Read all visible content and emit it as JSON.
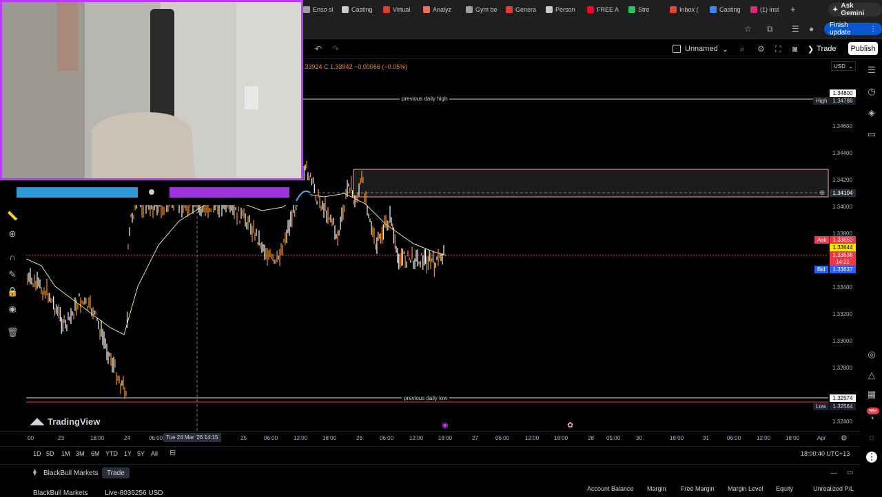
{
  "browser": {
    "tabs": [
      {
        "label": "Enso sl",
        "icon": "enso-icon",
        "color": "#9aa0a6"
      },
      {
        "label": "Casting",
        "icon": "casting-icon",
        "color": "#c8c8c8"
      },
      {
        "label": "Virtual",
        "icon": "virtual-icon",
        "color": "#e53935"
      },
      {
        "label": "Analyz",
        "icon": "analyze-icon",
        "color": "#ef6c57"
      },
      {
        "label": "Gym be",
        "icon": "gym-icon",
        "color": "#9aa0a6"
      },
      {
        "label": "Genera",
        "icon": "generate-icon",
        "color": "#e53935"
      },
      {
        "label": "Person",
        "icon": "person-icon",
        "color": "#c8c8c8"
      },
      {
        "label": "FREE A",
        "icon": "youtube-icon",
        "color": "#ff0033"
      },
      {
        "label": "Stre",
        "icon": "stream-icon",
        "color": "#22c55e"
      },
      {
        "label": "Inbox (",
        "icon": "gmail-icon",
        "color": "#ea4335"
      },
      {
        "label": "Casting",
        "icon": "casting2-icon",
        "color": "#3b82f6"
      },
      {
        "label": "(1) inst",
        "icon": "instagram-icon",
        "color": "#d62976"
      }
    ],
    "new_tab": "+",
    "ask_gemini": "Ask Gemini",
    "finish_update": "Finish update"
  },
  "toolbar": {
    "layout_name": "Unnamed",
    "trade": "Trade",
    "publish": "Publish"
  },
  "chart": {
    "ohlc_text": ".33924 C 1.33942 −0.00066 (−0.05%)",
    "currency": "USD",
    "levels": [
      {
        "name": "previous daily high",
        "price": "1.34788",
        "tag": "High"
      },
      {
        "name": "previous daily low",
        "price": "1.32564",
        "tag": "Low"
      }
    ],
    "price_ticks": [
      "1.34600",
      "1.34400",
      "1.34200",
      "1.34000",
      "1.33800",
      "1.33400",
      "1.33200",
      "1.33000",
      "1.32800",
      "1.32400"
    ],
    "highlight_labels": {
      "top": "1.34800",
      "crosshair": "1.34104",
      "ask_tag": "Ask",
      "ask_price": "1.33650",
      "mid_price": "1.33644",
      "bid_price_red": "1.33638",
      "countdown": "14:21",
      "bid_tag": "Bid",
      "bid_price": "1.33637",
      "low_top": "1.32574"
    },
    "time_labels": [
      {
        "text": ":00"
      },
      {
        "text": "23"
      },
      {
        "text": "18:00"
      },
      {
        "text": "24"
      },
      {
        "text": "06:00"
      },
      {
        "text": "25"
      },
      {
        "text": "06:00"
      },
      {
        "text": "12:00"
      },
      {
        "text": "18:00"
      },
      {
        "text": "26"
      },
      {
        "text": "06:00"
      },
      {
        "text": "12:00"
      },
      {
        "text": "18:00"
      },
      {
        "text": "27"
      },
      {
        "text": "06:00"
      },
      {
        "text": "12:00"
      },
      {
        "text": "18:00"
      },
      {
        "text": "28"
      },
      {
        "text": "05:00"
      },
      {
        "text": "30"
      },
      {
        "text": "18:00"
      },
      {
        "text": "31"
      },
      {
        "text": "06:00"
      },
      {
        "text": "12:00"
      },
      {
        "text": "18:00"
      },
      {
        "text": "Apr"
      }
    ],
    "time_cursor": "Tue 24 Mar '26   14:15",
    "logo_text": "TradingView"
  },
  "ranges": [
    "1D",
    "5D",
    "1M",
    "3M",
    "6M",
    "YTD",
    "1Y",
    "5Y",
    "All"
  ],
  "clock": "18:00:40 UTC+13",
  "bottom": {
    "broker": "BlackBull Markets",
    "trade_tab": "Trade",
    "account_name": "BlackBull Markets",
    "account_id": "Live-8036256 USD",
    "columns": [
      "Account Balance",
      "Margin",
      "Free Margin",
      "Margin Level",
      "Equity",
      "Unrealized P/L"
    ],
    "notifications": "99+"
  },
  "colors": {
    "accent": "#2962ff",
    "ask": "#f23645",
    "bid": "#2962ff",
    "candle_up": "#ffffff",
    "candle_down": "#f7931a",
    "webcam_border": "#b83cff"
  }
}
